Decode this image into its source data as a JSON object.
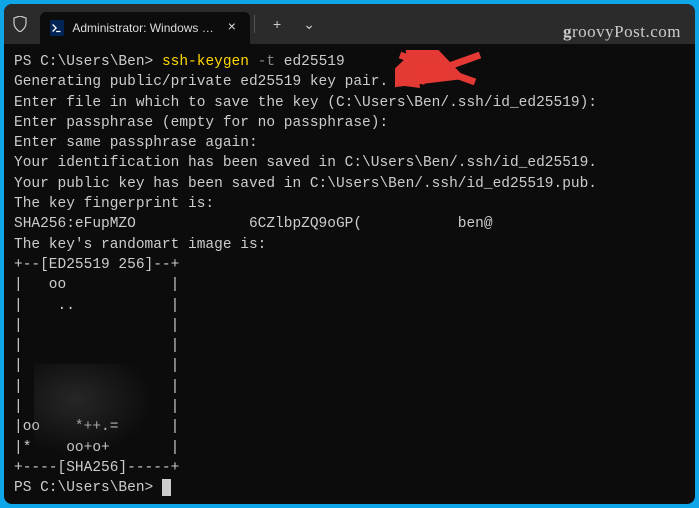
{
  "watermark": "groovyPost.com",
  "watermark_prefix": "g",
  "watermark_rest": "roovyPost.com",
  "tab": {
    "title": "Administrator: Windows Powe",
    "new_tab": "+",
    "dropdown": "⌄",
    "close": "×"
  },
  "terminal": {
    "prompt1_prefix": "PS C:\\Users\\Ben> ",
    "cmd_name": "ssh-keygen",
    "cmd_flag": " -t",
    "cmd_arg": " ed25519",
    "line2": "Generating public/private ed25519 key pair.",
    "line3": "Enter file in which to save the key (C:\\Users\\Ben/.ssh/id_ed25519):",
    "line4": "Enter passphrase (empty for no passphrase):",
    "line5": "Enter same passphrase again:",
    "line6": "Your identification has been saved in C:\\Users\\Ben/.ssh/id_ed25519.",
    "line7": "Your public key has been saved in C:\\Users\\Ben/.ssh/id_ed25519.pub.",
    "line8": "The key fingerprint is:",
    "line9": "SHA256:eFupMZO             6CZlbpZQ9oGP(           ben@",
    "line10": "The key's randomart image is:",
    "art1": "+--[ED25519 256]--+",
    "art2": "|   oo            |",
    "art3": "|    ..           |",
    "art4": "|                 |",
    "art5": "|                 |",
    "art6": "|                 |",
    "art7": "|                 |",
    "art8": "|                 |",
    "art9": "|oo    *++.=      |",
    "art10": "|*    oo+o+       |",
    "art11": "+----[SHA256]-----+",
    "prompt2": "PS C:\\Users\\Ben> "
  }
}
